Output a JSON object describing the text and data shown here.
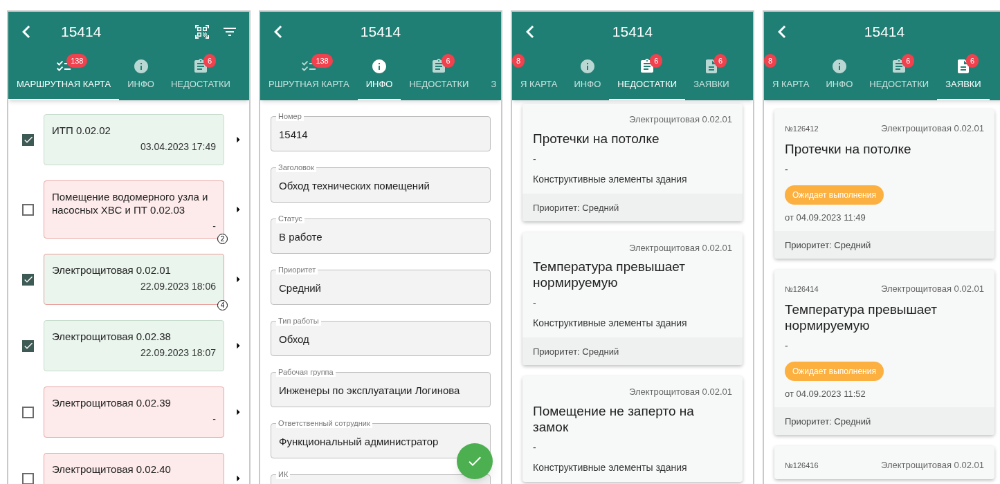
{
  "screens": [
    {
      "kind": "route",
      "title": "15414",
      "tabs": [
        {
          "kind": "route",
          "label": "МАРШРУТНАЯ КАРТА",
          "badge": "138",
          "selected": true
        },
        {
          "kind": "info",
          "label": "ИНФО",
          "selected": false
        },
        {
          "kind": "defects",
          "label": "НЕДОСТАТКИ",
          "badge": "6",
          "selected": false
        }
      ],
      "items": [
        {
          "kind": "done",
          "checked": true,
          "title": "ИТП 0.02.02",
          "date": "03.04.2023 17:49"
        },
        {
          "kind": "missed",
          "checked": false,
          "title": "Помещение водомерного узла и насосных ХВС и ПТ 0.02.03",
          "date": "-",
          "count": "2"
        },
        {
          "kind": "issues",
          "checked": true,
          "title": "Электрощитовая 0.02.01",
          "date": "22.09.2023 18:06",
          "count": "4"
        },
        {
          "kind": "done",
          "checked": true,
          "title": "Электрощитовая 0.02.38",
          "date": "22.09.2023 18:07"
        },
        {
          "kind": "missed",
          "checked": false,
          "title": "Электрощитовая 0.02.39",
          "date": "-"
        },
        {
          "kind": "missed",
          "checked": false,
          "title": "Электрощитовая 0.02.40"
        }
      ]
    },
    {
      "kind": "info",
      "title": "15414",
      "tabs": [
        {
          "kind": "route",
          "label": "РШРУТНАЯ КАРТА",
          "badge": "138",
          "selected": false
        },
        {
          "kind": "info",
          "label": "ИНФО",
          "selected": true
        },
        {
          "kind": "defects",
          "label": "НЕДОСТАТКИ",
          "badge": "6",
          "selected": false
        },
        {
          "kind": "cut",
          "label": "З",
          "selected": false
        }
      ],
      "fields": [
        {
          "label": "Номер",
          "value": "15414"
        },
        {
          "label": "Заголовок",
          "value": "Обход технических помещений"
        },
        {
          "label": "Статус",
          "value": "В работе"
        },
        {
          "label": "Приоритет",
          "value": "Средний"
        },
        {
          "label": "Тип работы",
          "value": "Обход"
        },
        {
          "label": "Рабочая группа",
          "value": "Инженеры по эксплуатации Логинова"
        },
        {
          "label": "Ответственный сотрудник",
          "value": "Функциональный администратор"
        },
        {
          "label": "ИК"
        }
      ]
    },
    {
      "kind": "defects",
      "title": "15414",
      "tabs": [
        {
          "kind": "cut",
          "label": "Я КАРТА",
          "badge": "8",
          "selected": false
        },
        {
          "kind": "info",
          "label": "ИНФО",
          "selected": false
        },
        {
          "kind": "defects",
          "label": "НЕДОСТАТКИ",
          "badge": "6",
          "selected": true
        },
        {
          "kind": "requests",
          "label": "ЗАЯВКИ",
          "badge": "6",
          "selected": false
        }
      ],
      "cards": [
        {
          "location": "Электрощитовая 0.02.01",
          "title": "Протечки на потолке",
          "description": "-",
          "category": "Конструктивные элементы здания",
          "priority": "Приоритет: Средний"
        },
        {
          "location": "Электрощитовая 0.02.01",
          "title": "Температура превышает нормируемую",
          "description": "-",
          "category": "Конструктивные элементы здания",
          "priority": "Приоритет: Средний"
        },
        {
          "location": "Электрощитовая 0.02.01",
          "title": "Помещение не заперто на замок",
          "description": "-",
          "category": "Конструктивные элементы здания"
        }
      ]
    },
    {
      "kind": "requests",
      "title": "15414",
      "tabs": [
        {
          "kind": "cut",
          "label": "Я КАРТА",
          "badge": "8",
          "selected": false
        },
        {
          "kind": "info",
          "label": "ИНФО",
          "selected": false
        },
        {
          "kind": "defects",
          "label": "НЕДОСТАТКИ",
          "badge": "6",
          "selected": false
        },
        {
          "kind": "requests",
          "label": "ЗАЯВКИ",
          "badge": "6",
          "selected": true
        }
      ],
      "cards": [
        {
          "number": "№126412",
          "location": "Электрощитовая 0.02.01",
          "title": "Протечки на потолке",
          "description": "-",
          "status": "Ожидает выполнения",
          "date": "от 04.09.2023 11:49",
          "priority": "Приоритет: Средний"
        },
        {
          "number": "№126414",
          "location": "Электрощитовая 0.02.01",
          "title": "Температура превышает нормируемую",
          "description": "-",
          "status": "Ожидает выполнения",
          "date": "от 04.09.2023 11:52",
          "priority": "Приоритет: Средний"
        },
        {
          "number": "№126416",
          "location": "Электрощитовая 0.02.01"
        }
      ]
    }
  ]
}
